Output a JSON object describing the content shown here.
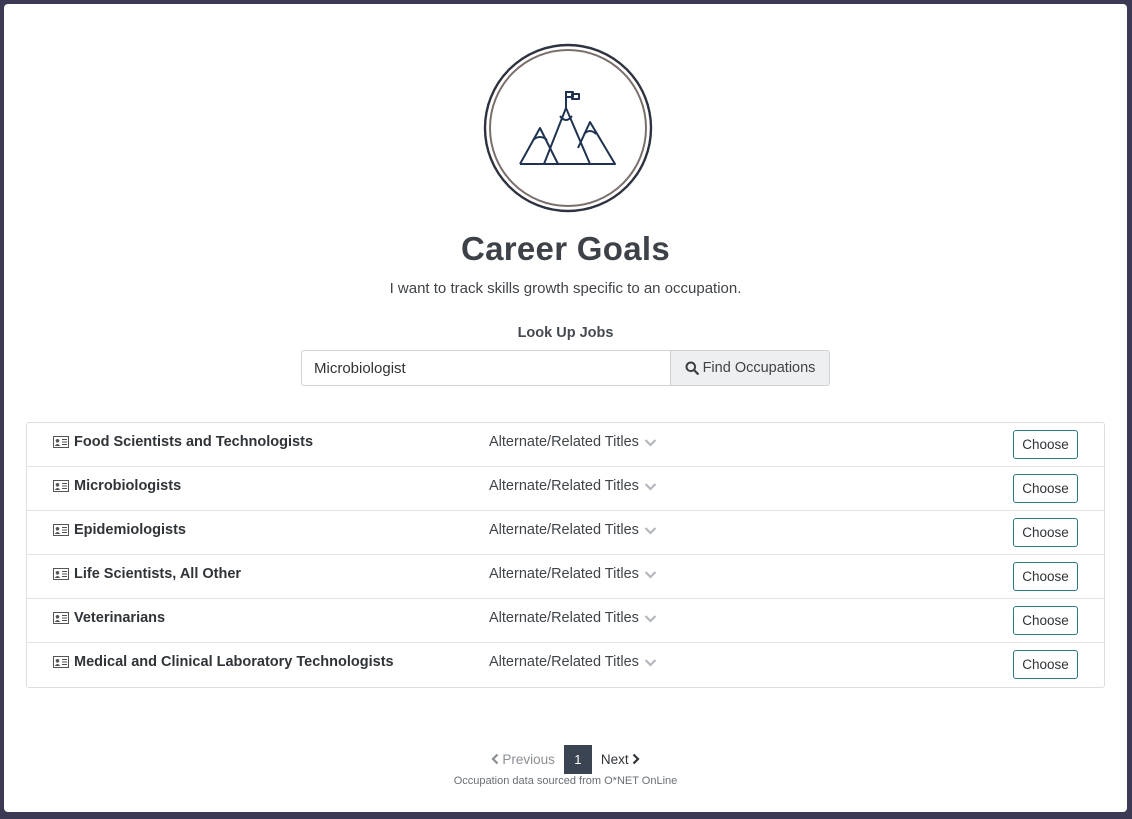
{
  "header": {
    "logo_icon": "mountain-flag-icon",
    "title": "Career Goals",
    "subtitle": "I want to track skills growth specific to an occupation."
  },
  "search": {
    "label": "Look Up Jobs",
    "value": "Microbiologist",
    "button_label": "Find Occupations"
  },
  "results": [
    {
      "title": "Food Scientists and Technologists",
      "alt_label": "Alternate/Related Titles",
      "button": "Choose"
    },
    {
      "title": "Microbiologists",
      "alt_label": "Alternate/Related Titles",
      "button": "Choose"
    },
    {
      "title": "Epidemiologists",
      "alt_label": "Alternate/Related Titles",
      "button": "Choose"
    },
    {
      "title": "Life Scientists, All Other",
      "alt_label": "Alternate/Related Titles",
      "button": "Choose"
    },
    {
      "title": "Veterinarians",
      "alt_label": "Alternate/Related Titles",
      "button": "Choose"
    },
    {
      "title": "Medical and Clinical Laboratory Technologists",
      "alt_label": "Alternate/Related Titles",
      "button": "Choose"
    }
  ],
  "pagination": {
    "previous": "Previous",
    "current": "1",
    "next": "Next"
  },
  "footer": {
    "source": "Occupation data sourced from O*NET OnLine"
  },
  "colors": {
    "background": "#3c3a52",
    "accent": "#2b7a86",
    "active_page": "#3a4452"
  }
}
